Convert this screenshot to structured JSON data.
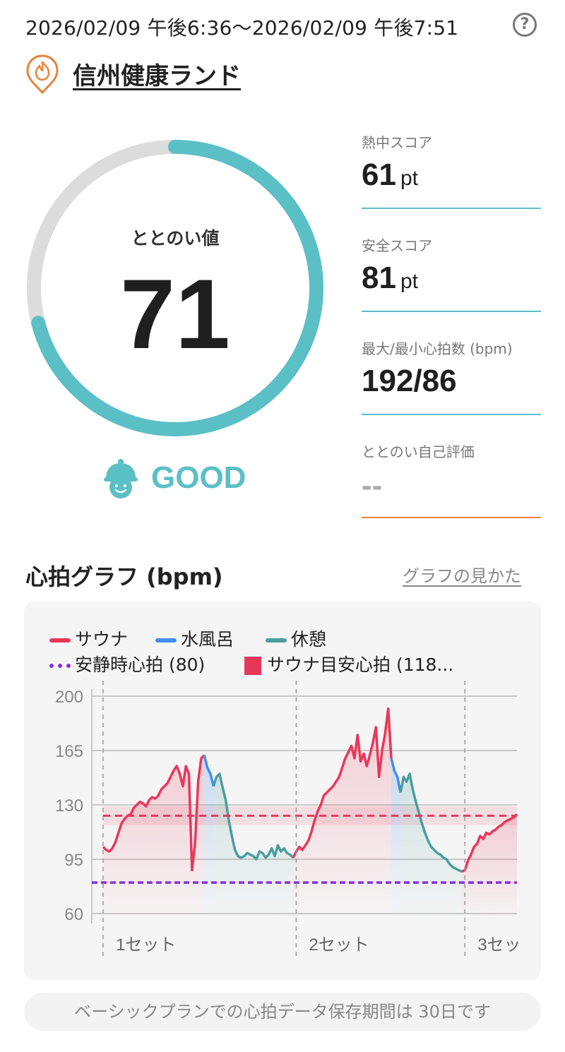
{
  "header": {
    "date_range": "2026/02/09 午後6:36～2026/02/09 午後7:51",
    "help_label": "?",
    "facility_name": "信州健康ランド"
  },
  "score": {
    "label": "ととのい値",
    "value": "71",
    "value_numeric": 71,
    "max": 100,
    "rating": "GOOD",
    "ring_color": "#5bbfc6",
    "track_color": "#dcdcdc"
  },
  "metrics": [
    {
      "label": "熱中スコア",
      "value": "61",
      "unit": "pt"
    },
    {
      "label": "安全スコア",
      "value": "81",
      "unit": "pt"
    },
    {
      "label": "最大/最小心拍数 (bpm)",
      "value": "192/86",
      "unit": ""
    },
    {
      "label": "ととのい自己評価",
      "value": "--",
      "unit": ""
    }
  ],
  "graph_section": {
    "title": "心拍グラフ (bpm)",
    "link": "グラフの見かた"
  },
  "legend": {
    "sauna": "サウナ",
    "cold_bath": "水風呂",
    "rest": "休憩",
    "resting_hr": "安静時心拍 (80)",
    "sauna_target": "サウナ目安心拍 (118..."
  },
  "colors": {
    "sauna": "#e8385a",
    "cold_bath": "#3f8ef0",
    "rest": "#4a9e9e",
    "resting_hr": "#8a2be2",
    "sauna_target": "#e8385a",
    "orange": "#e8833a"
  },
  "chart_data": {
    "type": "line",
    "yticks": [
      200,
      165,
      130,
      95,
      60
    ],
    "ylim": [
      60,
      200
    ],
    "x_labels": [
      "1セット",
      "2セット",
      "3セッ"
    ],
    "resting_hr": 80,
    "target_hr": 123,
    "target_band": [
      117,
      129
    ],
    "series": [
      {
        "name": "サウナ",
        "values": [
          103,
          101,
          100,
          102,
          106,
          112,
          118,
          121,
          123,
          124,
          128,
          130,
          132,
          131,
          129,
          133,
          135,
          134,
          136,
          140,
          142,
          144,
          148,
          152,
          155,
          150,
          142,
          155,
          150,
          88,
          105,
          145,
          160,
          162
        ]
      },
      {
        "name": "水風呂",
        "values": [
          154,
          150,
          142
        ]
      },
      {
        "name": "休憩",
        "values": [
          148,
          150,
          141,
          133,
          120,
          110,
          101,
          97,
          96,
          97,
          99,
          98,
          97,
          95,
          100,
          99,
          96,
          98,
          102,
          97,
          104,
          100,
          102,
          99,
          98,
          96
        ]
      },
      {
        "name": "サウナ",
        "values": [
          100,
          103,
          101,
          104,
          107,
          113,
          120,
          126,
          130,
          136,
          138,
          140,
          142,
          145,
          148,
          154,
          160,
          164,
          168,
          160,
          175,
          158,
          163,
          155,
          162,
          170,
          180,
          148,
          165,
          176,
          192,
          160
        ]
      },
      {
        "name": "水風呂",
        "values": [
          152,
          148,
          138
        ]
      },
      {
        "name": "休憩",
        "values": [
          148,
          145,
          150,
          140,
          132,
          125,
          118,
          112,
          107,
          103,
          101,
          99,
          98,
          96,
          95,
          92,
          90,
          89,
          88,
          87
        ]
      },
      {
        "name": "サウナ",
        "values": [
          88,
          94,
          98,
          103,
          105,
          110,
          108,
          112,
          111,
          113,
          114,
          116,
          117,
          119,
          120,
          121,
          122,
          124
        ]
      }
    ]
  },
  "footer_note": "ベーシックプランでの心拍データ保存期間は 30日です"
}
